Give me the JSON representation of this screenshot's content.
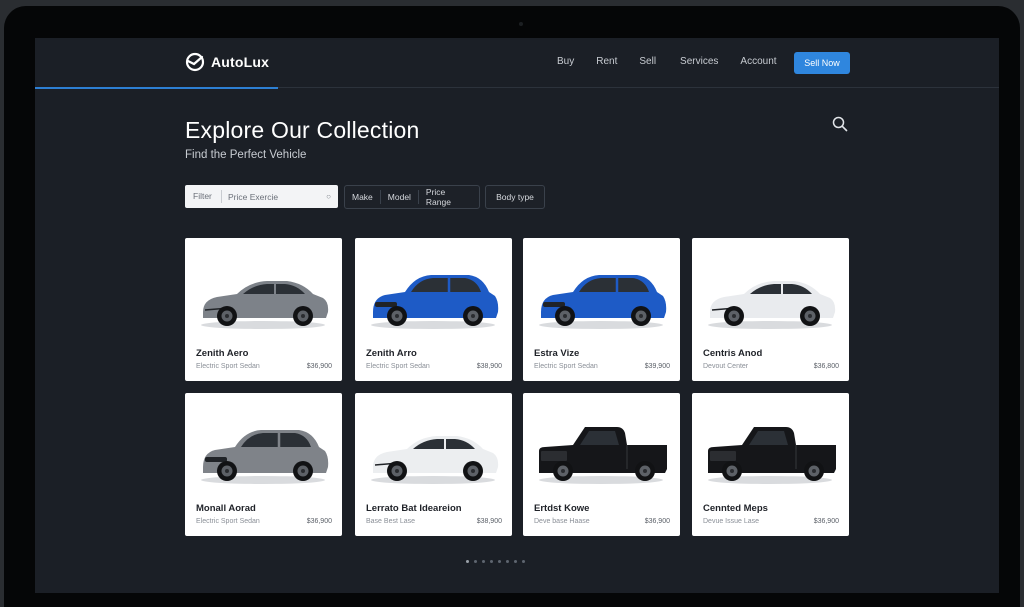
{
  "brand": {
    "name": "AutoLux"
  },
  "nav": {
    "items": [
      "Buy",
      "Rent",
      "Sell",
      "Services",
      "Account"
    ],
    "cta_label": "Sell Now"
  },
  "header": {
    "title": "Explore Our Collection",
    "subtitle": "Find the Perfect Vehicle"
  },
  "filters": {
    "filter_label": "Filter",
    "search_value": "Price Exercie",
    "clear_symbol": "○",
    "chips": [
      "Make",
      "Model",
      "Price Range"
    ],
    "body_type": "Body type"
  },
  "cars": [
    {
      "name": "Zenith Aero",
      "desc": "Electric Sport Sedan",
      "price": "$36,900",
      "color": "#7d8289",
      "style": "sedan"
    },
    {
      "name": "Zenith Arro",
      "desc": "Electric Sport Sedan",
      "price": "$38,900",
      "color": "#1e5bc6",
      "style": "suv"
    },
    {
      "name": "Estra Vize",
      "desc": "Electric Sport Sedan",
      "price": "$39,900",
      "color": "#1e5bc6",
      "style": "suv"
    },
    {
      "name": "Centris Anod",
      "desc": "Devout Center",
      "price": "$36,800",
      "color": "#e9ebee",
      "style": "sedan"
    },
    {
      "name": "Monall Aorad",
      "desc": "Electric Sport Sedan",
      "price": "$36,900",
      "color": "#7f8389",
      "style": "suv"
    },
    {
      "name": "Lerrato Bat Ideareion",
      "desc": "Base Best Lase",
      "price": "$38,900",
      "color": "#eceef0",
      "style": "sedan"
    },
    {
      "name": "Ertdst Kowe",
      "desc": "Deve base Haase",
      "price": "$36,900",
      "color": "#151619",
      "style": "truck"
    },
    {
      "name": "Cennted Meps",
      "desc": "Devue Issue Lase",
      "price": "$36,900",
      "color": "#151619",
      "style": "truck"
    }
  ],
  "pagination": {
    "count": 8,
    "active": 0
  },
  "colors": {
    "accent": "#2f86de",
    "background": "#1b1f26"
  }
}
